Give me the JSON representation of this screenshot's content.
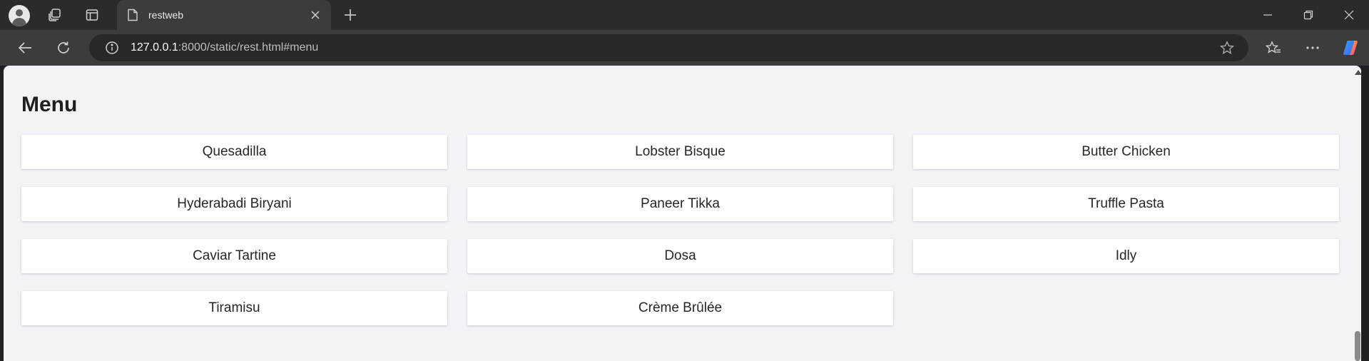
{
  "browser": {
    "tab_title": "restweb",
    "url_host": "127.0.0.1",
    "url_rest": ":8000/static/rest.html#menu"
  },
  "page": {
    "heading": "Menu",
    "items": [
      "Quesadilla",
      "Lobster Bisque",
      "Butter Chicken",
      "Hyderabadi Biryani",
      "Paneer Tikka",
      "Truffle Pasta",
      "Caviar Tartine",
      "Dosa",
      "Idly",
      "Tiramisu",
      "Crème Brûlée"
    ]
  }
}
